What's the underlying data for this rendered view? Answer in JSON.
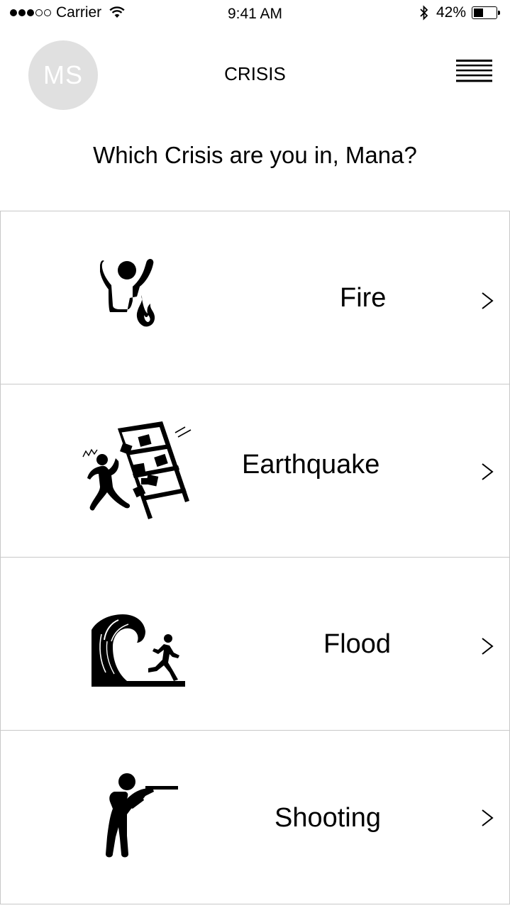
{
  "status_bar": {
    "signal_dots": [
      true,
      true,
      true,
      false,
      false
    ],
    "carrier": "Carrier",
    "time": "9:41 AM",
    "battery_percent": "42%",
    "battery_level": 0.42,
    "icons": [
      "wifi-icon",
      "bluetooth-icon",
      "battery-icon"
    ]
  },
  "header": {
    "avatar_initials": "MS",
    "title": "CRISIS",
    "menu_icon": "hamburger-menu-icon"
  },
  "prompt": "Which Crisis are you in, Mana?",
  "crises": [
    {
      "label": "Fire",
      "icon": "person-fire-icon"
    },
    {
      "label": "Earthquake",
      "icon": "earthquake-shelf-icon"
    },
    {
      "label": "Flood",
      "icon": "wave-running-person-icon"
    },
    {
      "label": "Shooting",
      "icon": "gunman-icon"
    }
  ],
  "colors": {
    "avatar_bg": "#e0e0e0",
    "divider": "#c8c8c8",
    "text": "#000000"
  }
}
